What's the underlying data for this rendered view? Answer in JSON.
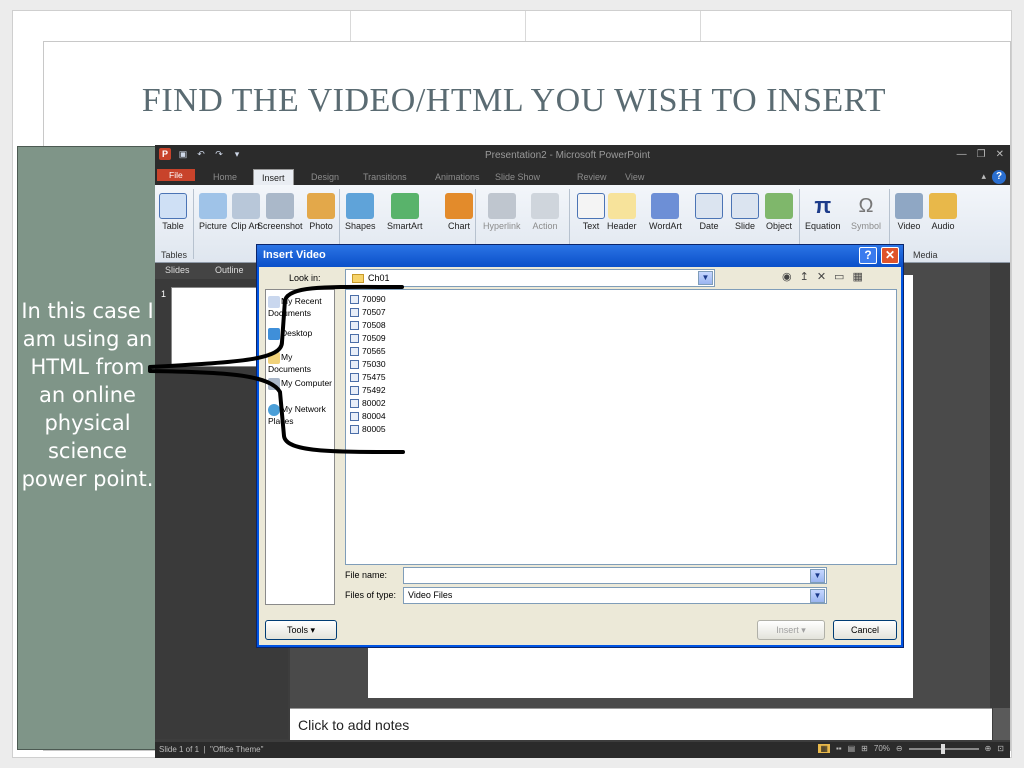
{
  "slide": {
    "title": "FIND THE VIDEO/HTML YOU WISH TO INSERT",
    "caption": "In this case I am using an HTML from an online physical science power point."
  },
  "powerpoint": {
    "document_title": "Presentation2 - Microsoft PowerPoint",
    "tabs": [
      "File",
      "Home",
      "Insert",
      "Design",
      "Transitions",
      "Animations",
      "Slide Show",
      "Review",
      "View"
    ],
    "active_tab": "Insert",
    "ribbon_buttons": [
      "Table",
      "Picture",
      "Clip Art",
      "Screenshot",
      "Photo",
      "Shapes",
      "SmartArt",
      "Chart",
      "Hyperlink",
      "Action",
      "Text",
      "Header",
      "WordArt",
      "Date",
      "Slide",
      "Object",
      "Equation",
      "Symbol",
      "Video",
      "Audio"
    ],
    "groups": {
      "tables": "Tables",
      "media": "Media"
    },
    "panel_tabs": {
      "slides": "Slides",
      "outline": "Outline"
    },
    "slide_number": "1",
    "notes_placeholder": "Click to add notes",
    "status": {
      "slide": "Slide 1 of 1",
      "theme": "\"Office Theme\"",
      "zoom": "70%"
    }
  },
  "dialog": {
    "title": "Insert Video",
    "look_in_label": "Look in:",
    "look_in_value": "Ch01",
    "places": [
      "My Recent Documents",
      "Desktop",
      "My Documents",
      "My Computer",
      "My Network Places"
    ],
    "files": [
      "70090",
      "70507",
      "70508",
      "70509",
      "70565",
      "75030",
      "75475",
      "75492",
      "80002",
      "80004",
      "80005"
    ],
    "file_name_label": "File name:",
    "file_name_value": "",
    "files_of_type_label": "Files of type:",
    "files_of_type_value": "Video Files",
    "tools_label": "Tools",
    "insert_label": "Insert",
    "cancel_label": "Cancel"
  },
  "colors": {
    "caption_box": "#7f9588",
    "title_text": "#5a6b72",
    "file_tab": "#c8432b",
    "dialog_title": "#0a4fc9"
  }
}
